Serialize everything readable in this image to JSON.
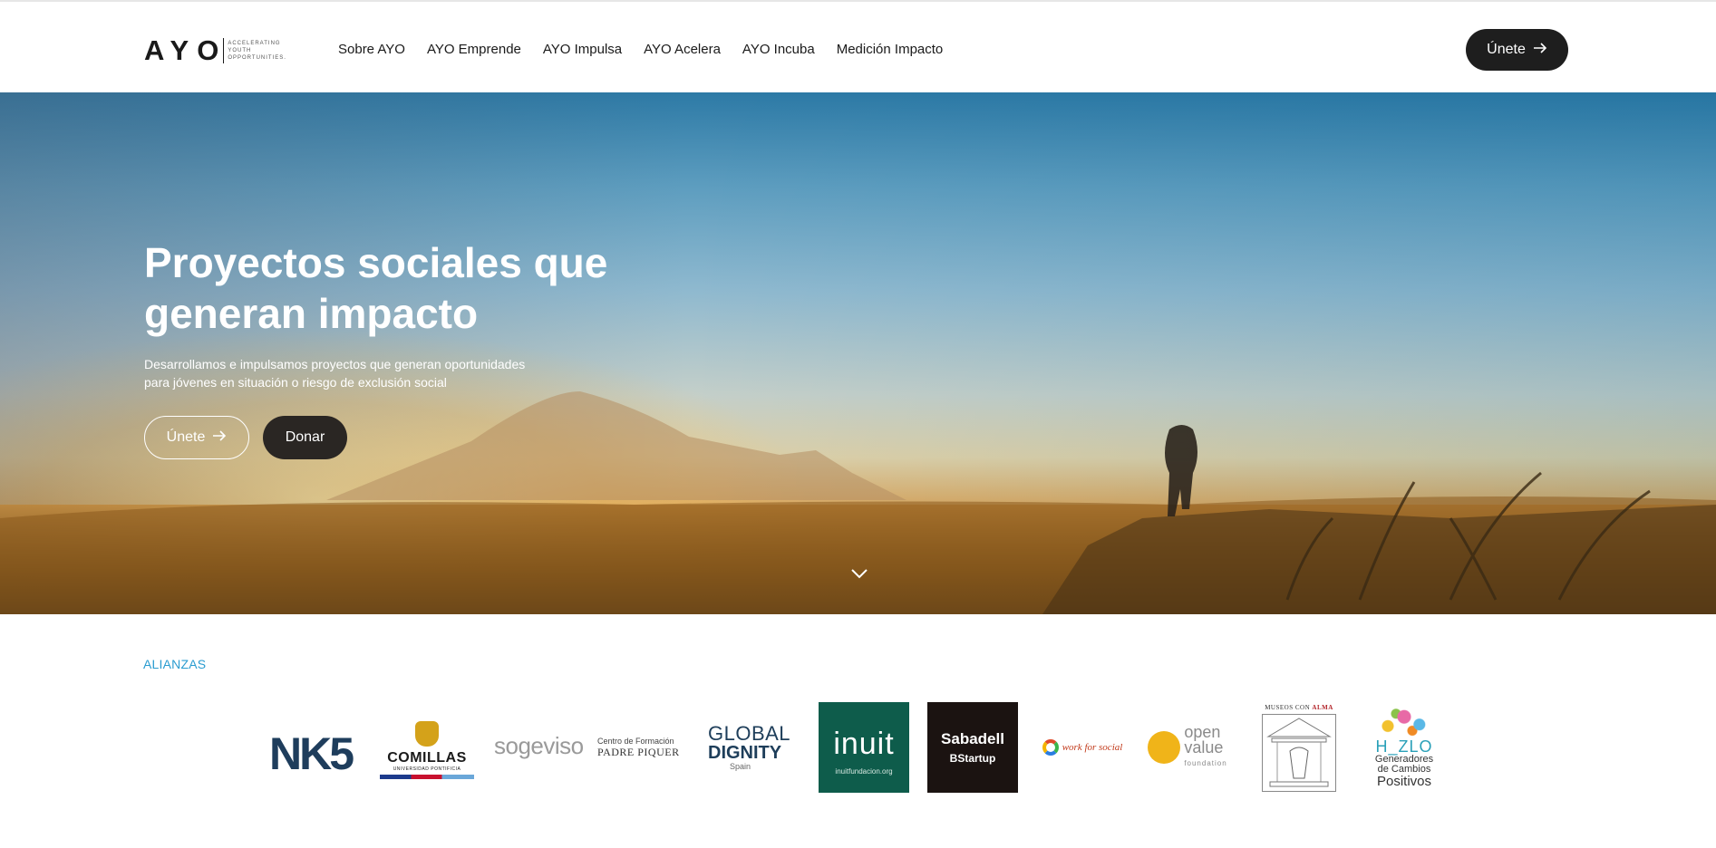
{
  "header": {
    "logo": {
      "word": "AYO",
      "tagline": [
        "ACCELERATING",
        "YOUTH",
        "OPPORTUNITIES."
      ]
    },
    "nav": [
      {
        "label": "Sobre AYO"
      },
      {
        "label": "AYO Emprende"
      },
      {
        "label": "AYO Impulsa"
      },
      {
        "label": "AYO Acelera"
      },
      {
        "label": "AYO Incuba"
      },
      {
        "label": "Medición Impacto"
      }
    ],
    "cta_label": "Únete"
  },
  "hero": {
    "title": "Proyectos sociales que generan impacto",
    "subtitle_line1": "Desarrollamos e impulsamos proyectos que generan oportunidades",
    "subtitle_line2": "para jóvenes en situación o riesgo de exclusión social",
    "primary_button": "Únete",
    "secondary_button": "Donar"
  },
  "alliances": {
    "label": "ALIANZAS",
    "logos": {
      "nk5": "NK5",
      "comillas": {
        "name": "COMILLAS",
        "sub": "UNIVERSIDAD PONTIFICIA"
      },
      "sogeviso": "sogeviso",
      "padre_piquer": {
        "top": "Centro de Formación",
        "name": "PADRE PIQUER"
      },
      "global_dignity": {
        "l1": "GLOBAL",
        "l2": "DIGNITY",
        "l3": "Spain"
      },
      "inuit": {
        "name": "inuit",
        "site": "inuitfundacion.org"
      },
      "sabadell": {
        "name": "Sabadell",
        "sub": "BStartup"
      },
      "work_for_social": "work for social",
      "open_value": {
        "l1": "open",
        "l2": "value",
        "l3": "foundation"
      },
      "museos_con_alma": {
        "a": "MUSEOS CON",
        "b": "ALMA"
      },
      "hazlo": {
        "name": "H_ZLO",
        "l1": "Generadores",
        "l2": "de Cambios",
        "l3": "Positivos"
      }
    }
  },
  "colors": {
    "accent": "#2a9cd0",
    "dark_button": "#1e1e1e",
    "donate_button": "#2a2623"
  },
  "icons": {
    "arrow": "arrow-right-icon",
    "scroll": "chevron-down-icon"
  }
}
